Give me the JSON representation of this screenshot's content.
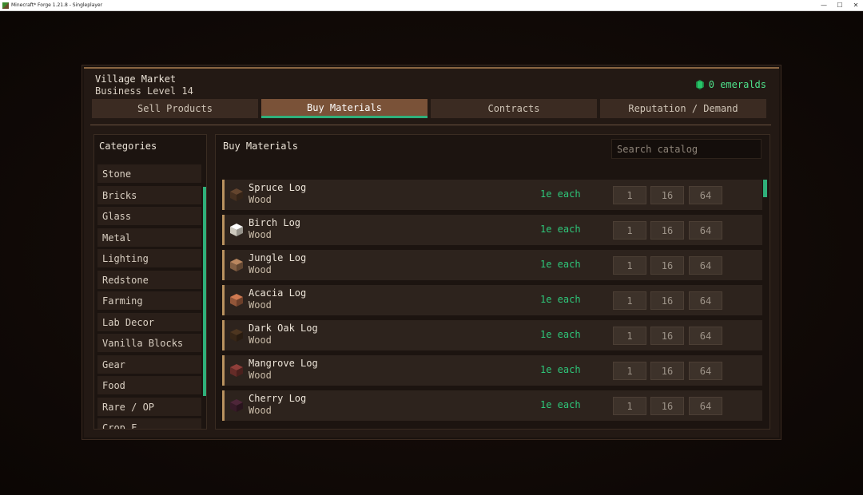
{
  "window": {
    "title": "Minecraft* Forge 1.21.8 - Singleplayer",
    "controls": [
      "—",
      "☐",
      "✕"
    ]
  },
  "market": {
    "title": "Village Market",
    "level": "Business Level 14",
    "emeralds": "0 emeralds"
  },
  "tabs": [
    {
      "label": "Sell Products",
      "active": false
    },
    {
      "label": "Buy Materials",
      "active": true
    },
    {
      "label": "Contracts",
      "active": false
    },
    {
      "label": "Reputation / Demand",
      "active": false
    }
  ],
  "sidebar": {
    "title": "Categories",
    "items": [
      "Stone",
      "Bricks",
      "Glass",
      "Metal",
      "Lighting",
      "Redstone",
      "Farming",
      "Lab Decor",
      "Vanilla Blocks",
      "Gear",
      "Food",
      "Rare / OP",
      "Crop F..."
    ]
  },
  "main": {
    "title": "Buy Materials",
    "search_placeholder": "Search catalog",
    "quantity_buttons": [
      "1",
      "16",
      "64"
    ],
    "rows": [
      {
        "name": "Spruce Log",
        "category": "Wood",
        "price": "1e each",
        "icon_color": "#4a3322"
      },
      {
        "name": "Birch Log",
        "category": "Wood",
        "price": "1e each",
        "icon_color": "#d8d4c8"
      },
      {
        "name": "Jungle Log",
        "category": "Wood",
        "price": "1e each",
        "icon_color": "#8a6446"
      },
      {
        "name": "Acacia Log",
        "category": "Wood",
        "price": "1e each",
        "icon_color": "#9a5a3c"
      },
      {
        "name": "Dark Oak Log",
        "category": "Wood",
        "price": "1e each",
        "icon_color": "#3a2818"
      },
      {
        "name": "Mangrove Log",
        "category": "Wood",
        "price": "1e each",
        "icon_color": "#6a2e2a"
      },
      {
        "name": "Cherry Log",
        "category": "Wood",
        "price": "1e each",
        "icon_color": "#3a1c2a"
      }
    ]
  },
  "colors": {
    "accent_green": "#2fb07a",
    "price_green": "#2ec77a",
    "active_tab": "#7a5238",
    "panel_bg": "#231914"
  }
}
